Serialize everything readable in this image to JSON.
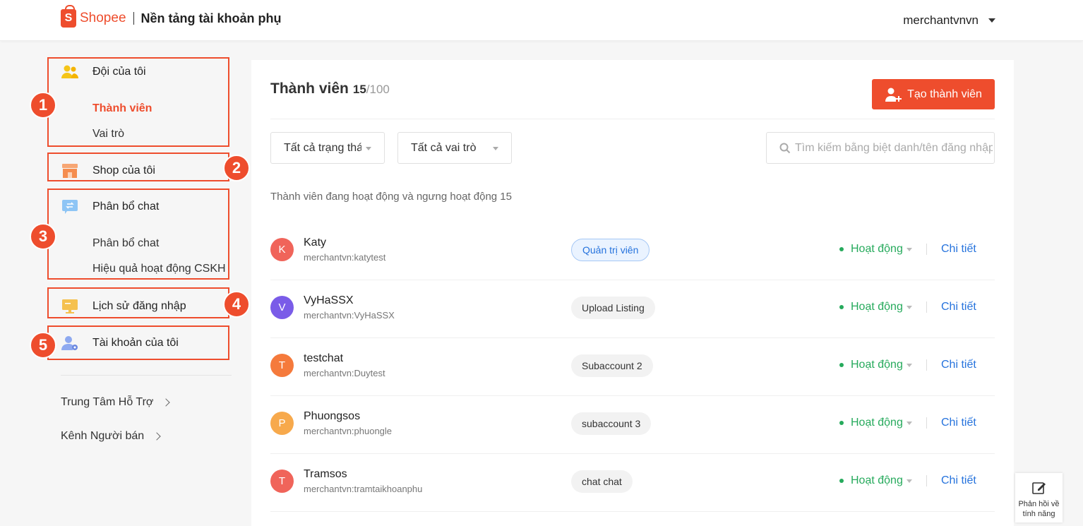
{
  "header": {
    "brand": "Shopee",
    "subtitle": "Nền tảng tài khoản phụ",
    "account": "merchantvnvn"
  },
  "sidebar": {
    "team": {
      "label": "Đội của tôi",
      "badge": "1",
      "subs": [
        "Thành viên",
        "Vai trò"
      ]
    },
    "shop": {
      "label": "Shop của tôi",
      "badge": "2"
    },
    "chat": {
      "label": "Phân bổ chat",
      "badge": "3",
      "subs": [
        "Phân bổ chat",
        "Hiệu quả hoạt động CSKH"
      ]
    },
    "login_history": {
      "label": "Lịch sử đăng nhập",
      "badge": "4"
    },
    "my_account": {
      "label": "Tài khoản của tôi",
      "badge": "5"
    },
    "links": [
      "Trung Tâm Hỗ Trợ",
      "Kênh Người bán"
    ]
  },
  "main": {
    "title": "Thành viên",
    "count": "15",
    "max": "/100",
    "create_label": "Tạo thành viên",
    "filter_status": "Tất cả trạng thái",
    "filter_role": "Tất cả vai trò",
    "search_placeholder": "Tìm kiếm bằng biệt danh/tên đăng nhập",
    "summary": "Thành viên đang hoạt động và ngưng hoạt động 15",
    "members": [
      {
        "initial": "K",
        "name": "Katy",
        "login": "merchantvn:katytest",
        "role": "Quản trị viên",
        "status": "Hoạt động",
        "action": "Chi tiết",
        "color": "#f0645a"
      },
      {
        "initial": "V",
        "name": "VyHaSSX",
        "login": "merchantvn:VyHaSSX",
        "role": "Upload Listing",
        "status": "Hoạt động",
        "action": "Chi tiết",
        "color": "#7a5ce8"
      },
      {
        "initial": "T",
        "name": "testchat",
        "login": "merchantvn:Duytest",
        "role": "Subaccount 2",
        "status": "Hoạt động",
        "action": "Chi tiết",
        "color": "#f57a3c"
      },
      {
        "initial": "P",
        "name": "Phuongsos",
        "login": "merchantvn:phuongle",
        "role": "subaccount 3",
        "status": "Hoạt động",
        "action": "Chi tiết",
        "color": "#f7a94c"
      },
      {
        "initial": "T",
        "name": "Tramsos",
        "login": "merchantvn:tramtaikhoanphu",
        "role": "chat chat",
        "status": "Hoạt động",
        "action": "Chi tiết",
        "color": "#f0645a"
      }
    ]
  },
  "feedback": {
    "line1": "Phản hồi về",
    "line2": "tính năng"
  },
  "colors": {
    "accent": "#ee4d2d",
    "active": "#26aa5c",
    "link": "#2673dd"
  }
}
